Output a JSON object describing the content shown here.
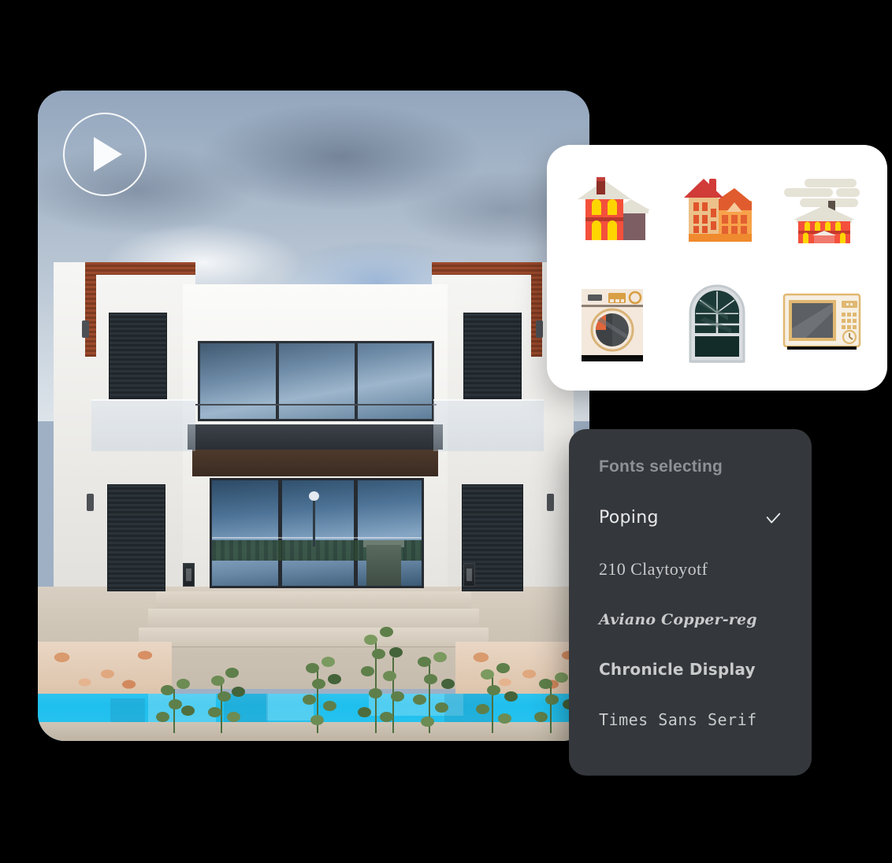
{
  "media": {
    "alt": "Modern white two-story villa with swimming pool at dusk",
    "play_button_label": "Play video"
  },
  "icon_panel": {
    "icons": [
      {
        "name": "house-icon",
        "label": "House"
      },
      {
        "name": "houses-icon",
        "label": "Houses"
      },
      {
        "name": "house-with-smoke-icon",
        "label": "House with smoke"
      },
      {
        "name": "washing-machine-icon",
        "label": "Washing machine"
      },
      {
        "name": "window-icon",
        "label": "Window"
      },
      {
        "name": "microwave-icon",
        "label": "Microwave"
      }
    ]
  },
  "fonts_panel": {
    "title": "Fonts selecting",
    "selected": "Poping",
    "check_icon": "check-icon",
    "options": [
      {
        "label": "Poping",
        "selected": true
      },
      {
        "label": "210 Claytoyotf",
        "selected": false
      },
      {
        "label": "Aviano Copper-reg",
        "selected": false
      },
      {
        "label": "Chronicle Display",
        "selected": false
      },
      {
        "label": "Times Sans Serif",
        "selected": false
      }
    ]
  },
  "colors": {
    "background": "#000000",
    "panel_light": "#ffffff",
    "panel_dark": "#34373b",
    "title_text": "#8e9297",
    "option_text": "#e8e9ea",
    "pool_cyan": "#25c2ee"
  }
}
